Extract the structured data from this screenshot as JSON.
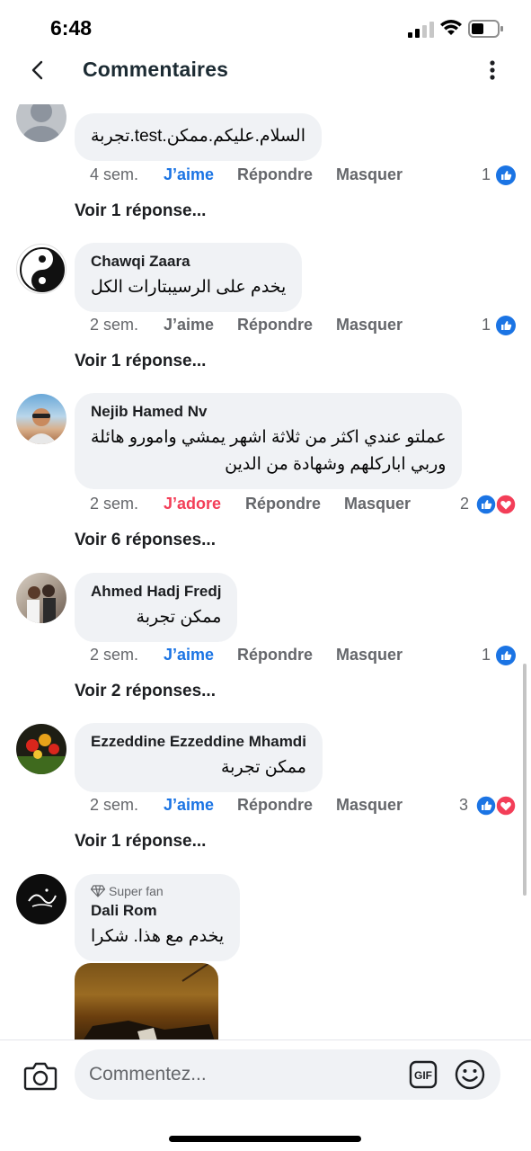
{
  "status_bar": {
    "time": "6:48"
  },
  "header": {
    "title": "Commentaires"
  },
  "comments": [
    {
      "author": "",
      "text": "السلام.عليكم.ممكن.test.تجربة",
      "time": "4 sem.",
      "reaction_label": "J’aime",
      "reply_label": "Répondre",
      "hide_label": "Masquer",
      "reaction_count": "1",
      "reactions": [
        "like"
      ],
      "replies_label": "Voir 1 réponse..."
    },
    {
      "author": "Chawqi Zaara",
      "text": "يخدم على الرسيبتارات الكل",
      "time": "2 sem.",
      "reaction_label": "J’aime",
      "reply_label": "Répondre",
      "hide_label": "Masquer",
      "reaction_count": "1",
      "reactions": [
        "like"
      ],
      "replies_label": "Voir 1 réponse..."
    },
    {
      "author": "Nejib Hamed Nv",
      "text_line1": "عملتو عندي اكثر من ثلاثة اشهر يمشي وامورو هائلة",
      "text_line2": "وربي اباركلهم وشهادة من الدين",
      "time": "2 sem.",
      "reaction_label": "J’adore",
      "reply_label": "Répondre",
      "hide_label": "Masquer",
      "reaction_count": "2",
      "reactions": [
        "like",
        "love"
      ],
      "replies_label": "Voir 6 réponses..."
    },
    {
      "author": "Ahmed Hadj Fredj",
      "text": "ممكن تجربة",
      "time": "2 sem.",
      "reaction_label": "J’aime",
      "reply_label": "Répondre",
      "hide_label": "Masquer",
      "reaction_count": "1",
      "reactions": [
        "like"
      ],
      "replies_label": "Voir 2 réponses..."
    },
    {
      "author": "Ezzeddine Ezzeddine Mhamdi",
      "text": "ممكن تجربة",
      "time": "2 sem.",
      "reaction_label": "J’aime",
      "reply_label": "Répondre",
      "hide_label": "Masquer",
      "reaction_count": "3",
      "reactions": [
        "like",
        "love"
      ],
      "replies_label": "Voir 1 réponse..."
    },
    {
      "badge": "Super fan",
      "author": "Dali Rom",
      "text": "يخدم مع هذا. شكرا"
    }
  ],
  "composer": {
    "placeholder": "Commentez...",
    "gif_label": "GIF"
  },
  "colors": {
    "like_blue": "#1b74e4",
    "love_red": "#f33e58",
    "bubble_bg": "#f0f2f5"
  }
}
